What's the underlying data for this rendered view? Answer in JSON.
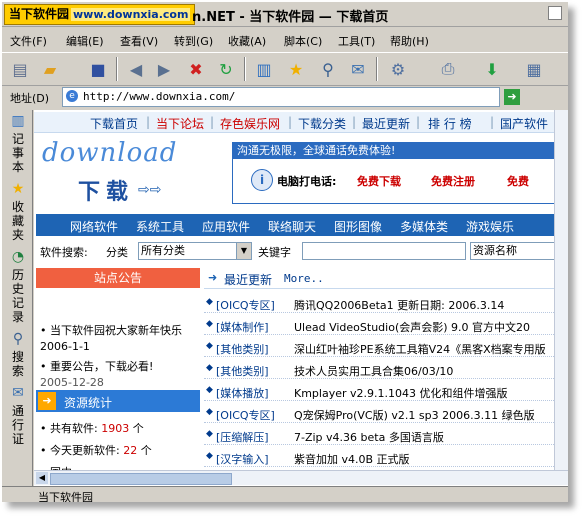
{
  "window": {
    "logo_text": "当下软件园",
    "logo_url": "www.downxia.com",
    "title_text": "n.NET - 当下软件园 — 下载首页"
  },
  "menu": [
    {
      "label": "文件(F)"
    },
    {
      "label": "编辑(E)"
    },
    {
      "label": "查看(V)"
    },
    {
      "label": "转到(G)"
    },
    {
      "label": "收藏(A)"
    },
    {
      "label": "脚本(C)"
    },
    {
      "label": "工具(T)"
    },
    {
      "label": "帮助(H)"
    }
  ],
  "address": {
    "label": "地址(D)",
    "url": "http://www.downxia.com/"
  },
  "sidebar": [
    {
      "label": "记事本",
      "icon": "notepad-icon"
    },
    {
      "label": "收藏夹",
      "icon": "star-icon"
    },
    {
      "label": "历史记录",
      "icon": "history-icon"
    },
    {
      "label": "搜索",
      "icon": "search-icon"
    },
    {
      "label": "通行证",
      "icon": "passport-icon"
    }
  ],
  "site_nav": [
    {
      "label": "下载首页"
    },
    {
      "label": "当下论坛"
    },
    {
      "label": "存色娱乐网"
    },
    {
      "label": "下载分类"
    },
    {
      "label": "最近更新"
    },
    {
      "label": "排 行 榜"
    },
    {
      "label": "国产软件"
    }
  ],
  "brand": {
    "logo_en": "download",
    "logo_cn": "下载"
  },
  "banner": {
    "headline": "沟通无极限，全球通话免费体验!",
    "label": "电脑打电话:",
    "links": [
      "免费下载",
      "免费注册",
      "免费"
    ]
  },
  "categories": [
    "网络软件",
    "系统工具",
    "应用软件",
    "联络聊天",
    "图形图像",
    "多媒体类",
    "游戏娱乐"
  ],
  "search": {
    "label": "软件搜索:",
    "category_label": "分类",
    "category_value": "所有分类",
    "keyword_label": "关键字",
    "field_value": "资源名称"
  },
  "announcement": {
    "title": "站点公告",
    "items": [
      "当下软件园祝大家新年快乐",
      "2006-1-1",
      "重要公告，下载必看!",
      "2005-12-28"
    ]
  },
  "stats": {
    "title": "资源统计",
    "total_label": "共有软件:",
    "total_value": "1903",
    "total_unit": "个",
    "today_label": "今天更新软件:",
    "today_value": "22",
    "today_unit": "个",
    "partial": "国内..."
  },
  "recent": {
    "title": "最近更新",
    "more": "More..",
    "items": [
      {
        "cat": "[OICQ专区]",
        "text": "腾讯QQ2006Beta1 更新日期: 2006.3.14"
      },
      {
        "cat": "[媒体制作]",
        "text": "Ulead VideoStudio(会声会影) 9.0 官方中文20"
      },
      {
        "cat": "[其他类别]",
        "text": "深山红叶袖珍PE系统工具箱V24《黑客X档案专用版"
      },
      {
        "cat": "[其他类别]",
        "text": "技术人员实用工具合集06/03/10"
      },
      {
        "cat": "[媒体播放]",
        "text": "Kmplayer v2.9.1.1043 优化和组件增强版"
      },
      {
        "cat": "[OICQ专区]",
        "text": "Q宠保姆Pro(VC版) v2.1 sp3 2006.3.11 绿色版"
      },
      {
        "cat": "[压缩解压]",
        "text": "7-Zip v4.36 beta 多国语言版"
      },
      {
        "cat": "[汉字输入]",
        "text": "紫音加加 v4.0B 正式版"
      }
    ]
  },
  "statusbar": {
    "text": "当下软件园"
  }
}
